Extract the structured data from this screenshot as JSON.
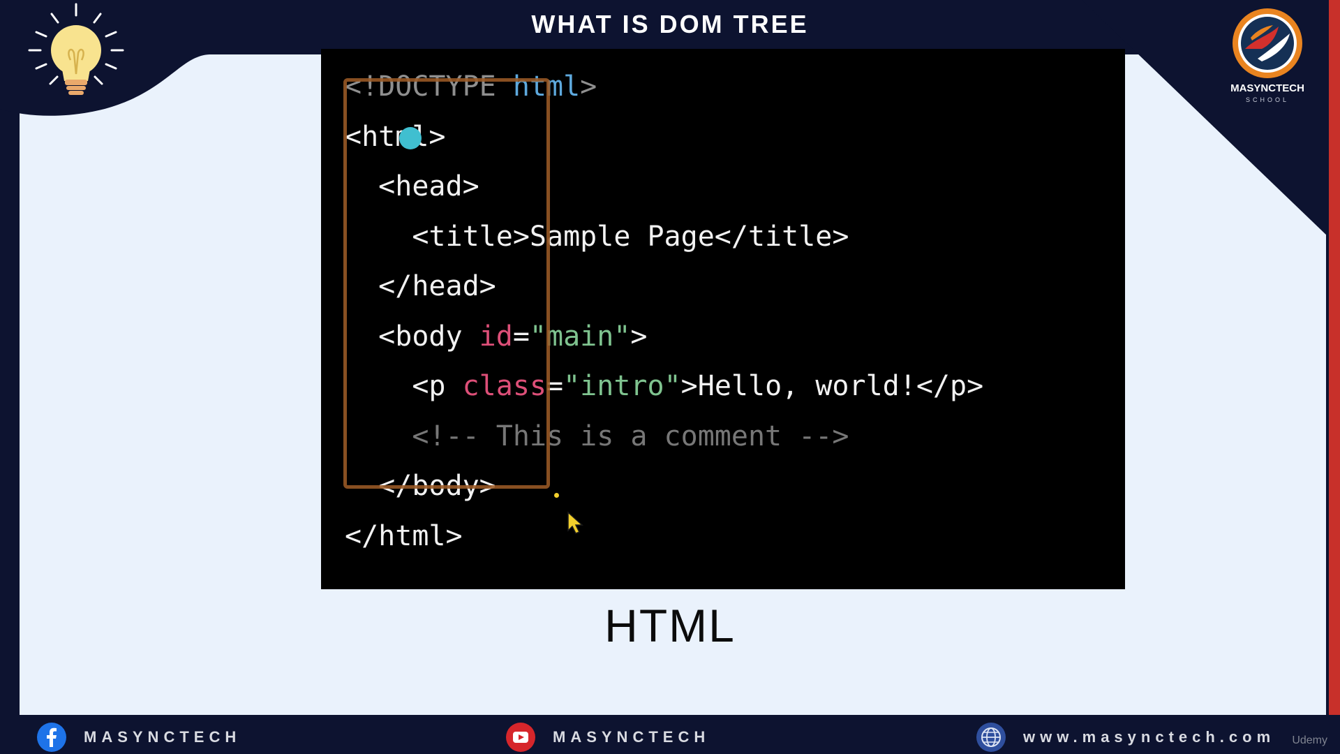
{
  "header": {
    "title": "WHAT IS DOM TREE",
    "logo_name": "MASYNCTECH",
    "logo_sub": "SCHOOL"
  },
  "code": {
    "lines": [
      [
        {
          "text": "<!DOCTYPE ",
          "color": "gray"
        },
        {
          "text": "html",
          "color": "blue"
        },
        {
          "text": ">",
          "color": "gray"
        }
      ],
      [
        {
          "text": "<html>",
          "color": "white"
        }
      ],
      [
        {
          "text": "  <head>",
          "color": "white"
        }
      ],
      [
        {
          "text": "    <title>Sample Page</title>",
          "color": "white"
        }
      ],
      [
        {
          "text": "  </head>",
          "color": "white"
        }
      ],
      [
        {
          "text": "  <body ",
          "color": "white"
        },
        {
          "text": "id",
          "color": "red"
        },
        {
          "text": "=",
          "color": "white"
        },
        {
          "text": "\"main\"",
          "color": "green"
        },
        {
          "text": ">",
          "color": "white"
        }
      ],
      [
        {
          "text": "    <p ",
          "color": "white"
        },
        {
          "text": "class",
          "color": "red"
        },
        {
          "text": "=",
          "color": "white"
        },
        {
          "text": "\"intro\"",
          "color": "green"
        },
        {
          "text": ">Hello, world!</p>",
          "color": "white"
        }
      ],
      [
        {
          "text": "    <!-- This is a comment -->",
          "color": "comment"
        }
      ],
      [
        {
          "text": "  </body>",
          "color": "white"
        }
      ],
      [
        {
          "text": "</html>",
          "color": "white"
        }
      ]
    ]
  },
  "caption": "HTML",
  "footer": {
    "facebook_label": "MASYNCTECH",
    "youtube_label": "MASYNCTECH",
    "website_label": "www.masynctech.com",
    "watermark": "Udemy"
  },
  "colors": {
    "background": "#0d1330",
    "panel": "#eaf2fc",
    "accent": "#c8302a",
    "code_bg": "#000000",
    "highlight": "#9b5a26"
  }
}
